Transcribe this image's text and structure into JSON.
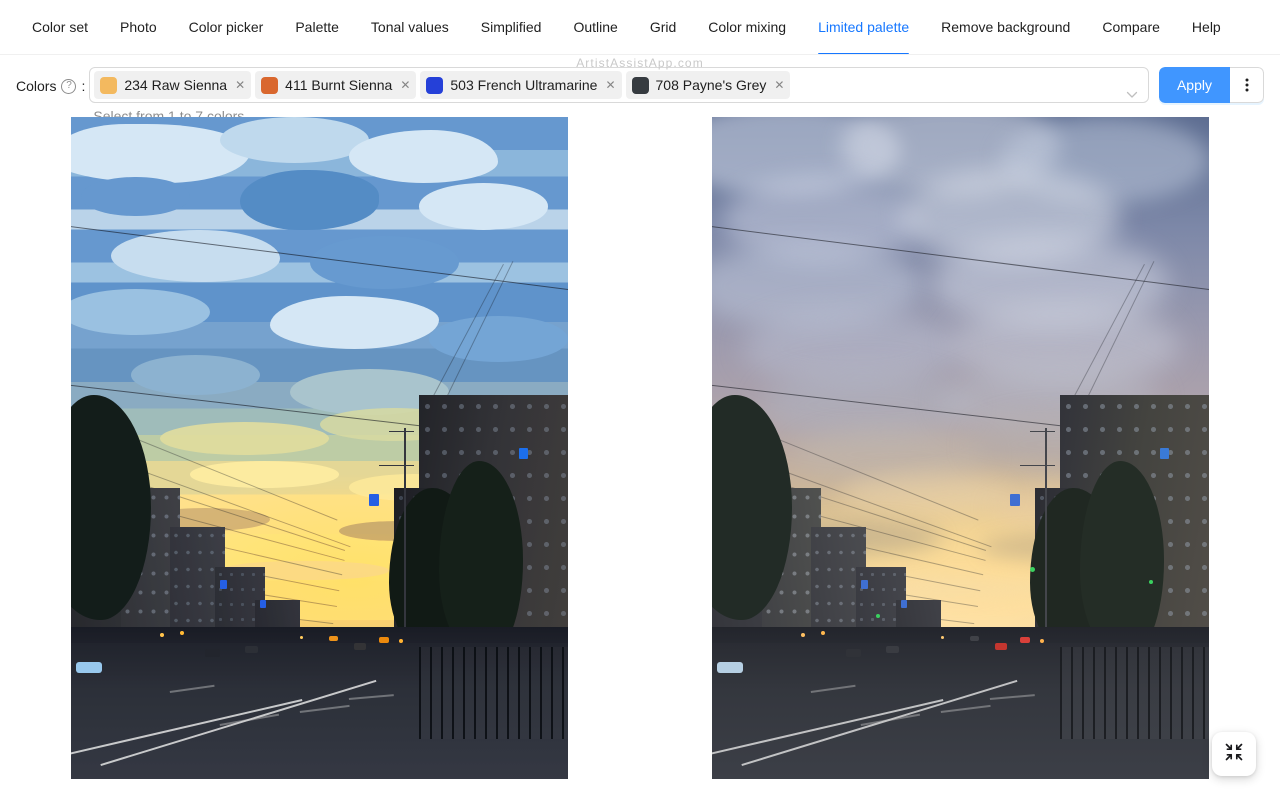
{
  "app": {
    "watermark": "ArtistAssistApp.com"
  },
  "nav": {
    "items": [
      {
        "label": "Color set",
        "active": false
      },
      {
        "label": "Photo",
        "active": false
      },
      {
        "label": "Color picker",
        "active": false
      },
      {
        "label": "Palette",
        "active": false
      },
      {
        "label": "Tonal values",
        "active": false
      },
      {
        "label": "Simplified",
        "active": false
      },
      {
        "label": "Outline",
        "active": false
      },
      {
        "label": "Grid",
        "active": false
      },
      {
        "label": "Color mixing",
        "active": false
      },
      {
        "label": "Limited palette",
        "active": true
      },
      {
        "label": "Remove background",
        "active": false
      },
      {
        "label": "Compare",
        "active": false
      },
      {
        "label": "Help",
        "active": false
      }
    ]
  },
  "toolbar": {
    "colors_label": "Colors",
    "help_icon": "question-circle-icon",
    "colon": ":",
    "hint": "Select from 1 to 7 colors",
    "apply_label": "Apply",
    "more_label": "⋮",
    "caret_icon": "chevron-down-icon",
    "select_placeholder": "",
    "selected_colors": [
      {
        "code": "234",
        "name": "234 Raw Sienna",
        "swatch": "#f3b95f",
        "remove_icon": "close-icon"
      },
      {
        "code": "411",
        "name": "411 Burnt Sienna",
        "swatch": "#d9672e",
        "remove_icon": "close-icon"
      },
      {
        "code": "503",
        "name": "503 French Ultramarine",
        "swatch": "#2540d8",
        "remove_icon": "close-icon"
      },
      {
        "code": "708",
        "name": "708 Payne's Grey",
        "swatch": "#363b40",
        "remove_icon": "close-icon"
      }
    ]
  },
  "viewer": {
    "left_pane_name": "limited-palette-result-image",
    "right_pane_name": "original-photo-image",
    "left_alt": "City street at sunset rendered with a limited 4-colour palette",
    "right_alt": "Original photo of a city street at sunset"
  },
  "fab": {
    "icon": "compress-arrows-icon",
    "label": ""
  },
  "colors": {
    "accent": "#1677ff",
    "apply_button": "#4096ff",
    "watermark_text": "#c9c9c9",
    "tag_background": "#f0f0f0"
  }
}
